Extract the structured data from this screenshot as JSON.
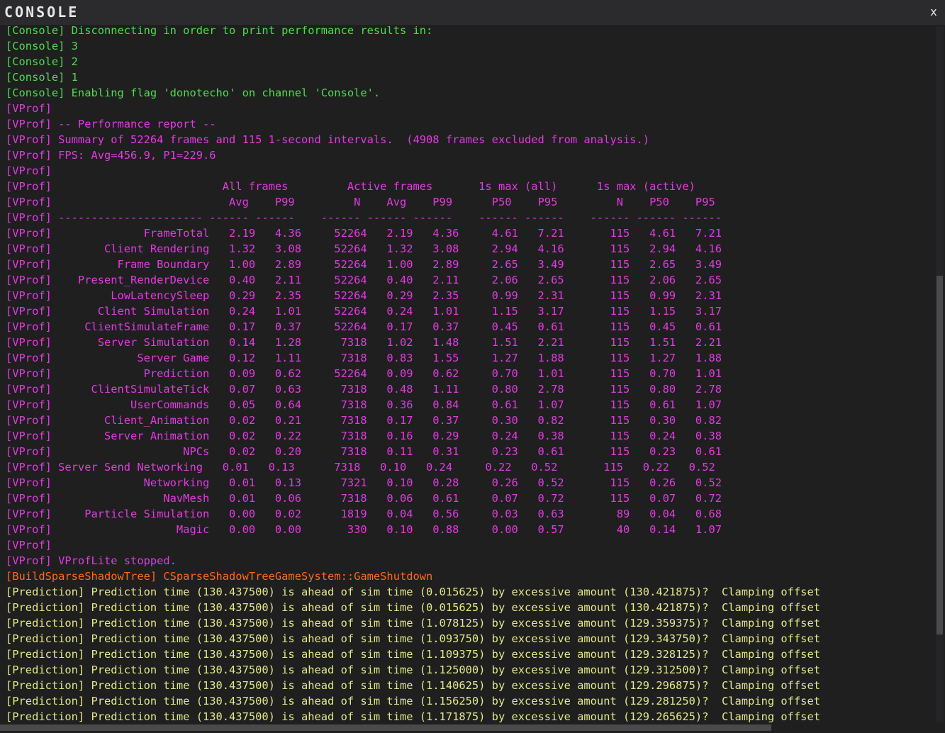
{
  "window": {
    "title": "CONSOLE",
    "close_label": "x"
  },
  "colors": {
    "console": "#4fdc4f",
    "vprof": "#e23be0",
    "build": "#ff6a17",
    "prediction": "#e2e886",
    "background": "#1f1f20",
    "titlebar": "#2b2b2d"
  },
  "log": {
    "lines": [
      {
        "type": "console",
        "text": "[Console] Disconnecting in order to print performance results in:"
      },
      {
        "type": "console",
        "text": "[Console] 3"
      },
      {
        "type": "console",
        "text": "[Console] 2"
      },
      {
        "type": "console",
        "text": "[Console] 1"
      },
      {
        "type": "console",
        "text": "[Console] Enabling flag 'donotecho' on channel 'Console'."
      },
      {
        "type": "vprof",
        "text": "[VProf]"
      },
      {
        "type": "vprof",
        "text": "[VProf] -- Performance report --"
      },
      {
        "type": "vprof",
        "text": "[VProf] Summary of 52264 frames and 115 1-second intervals.  (4908 frames excluded from analysis.)"
      },
      {
        "type": "vprof",
        "text": "[VProf] FPS: Avg=456.9, P1=229.6"
      },
      {
        "type": "vprof",
        "text": "[VProf]"
      },
      {
        "type": "vprof",
        "text": "[VProf]                          All frames         Active frames       1s max (all)      1s max (active)"
      },
      {
        "type": "vprof",
        "text": "[VProf]                           Avg    P99         N    Avg    P99      P50    P95         N    P50    P95"
      },
      {
        "type": "vprof",
        "text": "[VProf] ---------------------- ------ ------    ------ ------ ------    ------ ------    ------ ------ ------"
      },
      {
        "type": "vprof",
        "text": "[VProf]              FrameTotal   2.19   4.36     52264   2.19   4.36     4.61   7.21       115   4.61   7.21"
      },
      {
        "type": "vprof",
        "text": "[VProf]        Client Rendering   1.32   3.08     52264   1.32   3.08     2.94   4.16       115   2.94   4.16"
      },
      {
        "type": "vprof",
        "text": "[VProf]          Frame Boundary   1.00   2.89     52264   1.00   2.89     2.65   3.49       115   2.65   3.49"
      },
      {
        "type": "vprof",
        "text": "[VProf]    Present_RenderDevice   0.40   2.11     52264   0.40   2.11     2.06   2.65       115   2.06   2.65"
      },
      {
        "type": "vprof",
        "text": "[VProf]         LowLatencySleep   0.29   2.35     52264   0.29   2.35     0.99   2.31       115   0.99   2.31"
      },
      {
        "type": "vprof",
        "text": "[VProf]       Client Simulation   0.24   1.01     52264   0.24   1.01     1.15   3.17       115   1.15   3.17"
      },
      {
        "type": "vprof",
        "text": "[VProf]     ClientSimulateFrame   0.17   0.37     52264   0.17   0.37     0.45   0.61       115   0.45   0.61"
      },
      {
        "type": "vprof",
        "text": "[VProf]       Server Simulation   0.14   1.28      7318   1.02   1.48     1.51   2.21       115   1.51   2.21"
      },
      {
        "type": "vprof",
        "text": "[VProf]             Server Game   0.12   1.11      7318   0.83   1.55     1.27   1.88       115   1.27   1.88"
      },
      {
        "type": "vprof",
        "text": "[VProf]              Prediction   0.09   0.62     52264   0.09   0.62     0.70   1.01       115   0.70   1.01"
      },
      {
        "type": "vprof",
        "text": "[VProf]      ClientSimulateTick   0.07   0.63      7318   0.48   1.11     0.80   2.78       115   0.80   2.78"
      },
      {
        "type": "vprof",
        "text": "[VProf]            UserCommands   0.05   0.64      7318   0.36   0.84     0.61   1.07       115   0.61   1.07"
      },
      {
        "type": "vprof",
        "text": "[VProf]        Client_Animation   0.02   0.21      7318   0.17   0.37     0.30   0.82       115   0.30   0.82"
      },
      {
        "type": "vprof",
        "text": "[VProf]        Server Animation   0.02   0.22      7318   0.16   0.29     0.24   0.38       115   0.24   0.38"
      },
      {
        "type": "vprof",
        "text": "[VProf]                    NPCs   0.02   0.20      7318   0.11   0.31     0.23   0.61       115   0.23   0.61"
      },
      {
        "type": "vprof",
        "text": "[VProf] Server Send Networking   0.01   0.13      7318   0.10   0.24     0.22   0.52       115   0.22   0.52"
      },
      {
        "type": "vprof",
        "text": "[VProf]              Networking   0.01   0.13      7321   0.10   0.28     0.26   0.52       115   0.26   0.52"
      },
      {
        "type": "vprof",
        "text": "[VProf]                 NavMesh   0.01   0.06      7318   0.06   0.61     0.07   0.72       115   0.07   0.72"
      },
      {
        "type": "vprof",
        "text": "[VProf]     Particle Simulation   0.00   0.02      1819   0.04   0.56     0.03   0.63        89   0.04   0.68"
      },
      {
        "type": "vprof",
        "text": "[VProf]                   Magic   0.00   0.00       330   0.10   0.88     0.00   0.57        40   0.14   1.07"
      },
      {
        "type": "vprof",
        "text": "[VProf]"
      },
      {
        "type": "vprof",
        "text": "[VProf] VProfLite stopped."
      },
      {
        "type": "build",
        "text": "[BuildSparseShadowTree] CSparseShadowTreeGameSystem::GameShutdown"
      },
      {
        "type": "pred",
        "text": "[Prediction] Prediction time (130.437500) is ahead of sim time (0.015625) by excessive amount (130.421875)?  Clamping offset"
      },
      {
        "type": "pred",
        "text": "[Prediction] Prediction time (130.437500) is ahead of sim time (0.015625) by excessive amount (130.421875)?  Clamping offset"
      },
      {
        "type": "pred",
        "text": "[Prediction] Prediction time (130.437500) is ahead of sim time (1.078125) by excessive amount (129.359375)?  Clamping offset"
      },
      {
        "type": "pred",
        "text": "[Prediction] Prediction time (130.437500) is ahead of sim time (1.093750) by excessive amount (129.343750)?  Clamping offset"
      },
      {
        "type": "pred",
        "text": "[Prediction] Prediction time (130.437500) is ahead of sim time (1.109375) by excessive amount (129.328125)?  Clamping offset"
      },
      {
        "type": "pred",
        "text": "[Prediction] Prediction time (130.437500) is ahead of sim time (1.125000) by excessive amount (129.312500)?  Clamping offset"
      },
      {
        "type": "pred",
        "text": "[Prediction] Prediction time (130.437500) is ahead of sim time (1.140625) by excessive amount (129.296875)?  Clamping offset"
      },
      {
        "type": "pred",
        "text": "[Prediction] Prediction time (130.437500) is ahead of sim time (1.156250) by excessive amount (129.281250)?  Clamping offset"
      },
      {
        "type": "pred",
        "text": "[Prediction] Prediction time (130.437500) is ahead of sim time (1.171875) by excessive amount (129.265625)?  Clamping offset"
      }
    ]
  }
}
